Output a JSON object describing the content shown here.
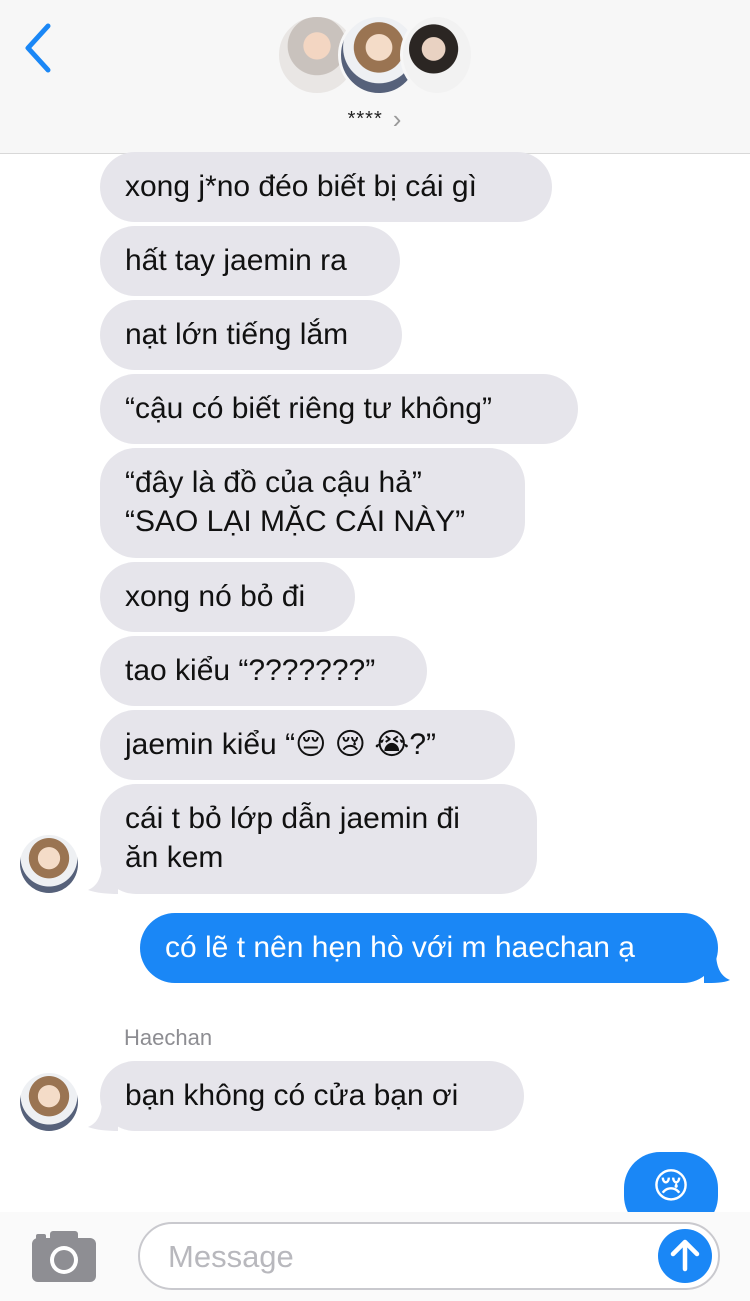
{
  "header": {
    "back_icon": "chevron-left-icon",
    "group_name": "****",
    "group_chevron": "›",
    "avatars": [
      "group-avatar-1",
      "group-avatar-2",
      "group-avatar-3"
    ]
  },
  "messages": [
    {
      "direction": "received",
      "text": "xong j*no đéo biết bị cái gì"
    },
    {
      "direction": "received",
      "text": "hất tay jaemin ra"
    },
    {
      "direction": "received",
      "text": "nạt lớn tiếng lắm"
    },
    {
      "direction": "received",
      "text": "“cậu có biết riêng tư không”"
    },
    {
      "direction": "received",
      "lines": [
        "“đây là đồ của cậu hả”",
        "“SAO LẠI MẶC CÁI NÀY”"
      ]
    },
    {
      "direction": "received",
      "text": "xong nó bỏ đi"
    },
    {
      "direction": "received",
      "text": "tao kiểu “???????”"
    },
    {
      "direction": "received",
      "text": "jaemin kiểu “😔 😢 😭?”"
    },
    {
      "direction": "received",
      "lines": [
        "cái t bỏ lớp dẫn jaemin đi",
        "ăn kem"
      ]
    },
    {
      "direction": "sent",
      "text": "có lẽ t nên hẹn hò với m haechan ạ"
    },
    {
      "direction": "received",
      "sender": "Haechan",
      "text": "bạn không có cửa bạn ơi"
    },
    {
      "direction": "sent",
      "text": "😢"
    }
  ],
  "input_bar": {
    "camera_icon": "camera-icon",
    "placeholder": "Message",
    "send_icon": "arrow-up-icon"
  },
  "colors": {
    "sent_bubble": "#1a87f6",
    "received_bubble": "#e6e5eb",
    "accent": "#1a87f6"
  }
}
